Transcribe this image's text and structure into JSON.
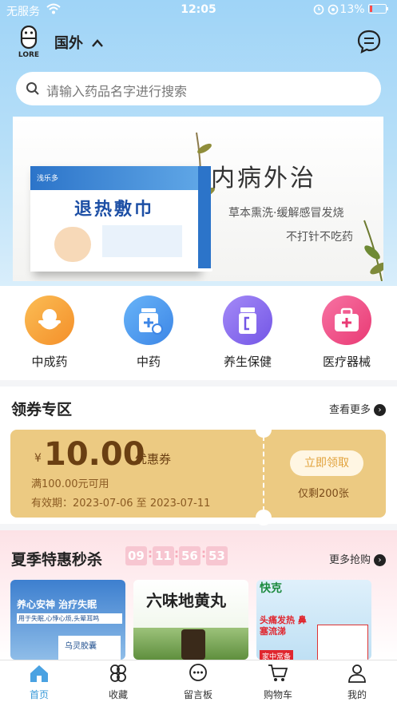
{
  "status_bar": {
    "carrier": "无服务",
    "time": "12:05",
    "battery": "13%"
  },
  "header": {
    "logo_text": "LORE",
    "location": "国外"
  },
  "search": {
    "placeholder": "请输入药品名字进行搜索"
  },
  "banner": {
    "product_name": "退热敷巾",
    "headline": "内病外治",
    "line1": "草本熏洗·缓解感冒发烧",
    "line2": "不打针不吃药",
    "brand": "浅乐多"
  },
  "categories": [
    {
      "label": "中成药",
      "color": "#f7a13c"
    },
    {
      "label": "中药",
      "color": "#4f9ef0"
    },
    {
      "label": "养生保健",
      "color": "#8a6ff0"
    },
    {
      "label": "医疗器械",
      "color": "#f2508a"
    }
  ],
  "coupon_section": {
    "title": "领券专区",
    "more": "查看更多"
  },
  "coupon": {
    "currency": "¥",
    "amount": "10.00",
    "type": "优惠券",
    "condition": "满100.00元可用",
    "validity": "有效期：2023-07-06 至 2023-07-11",
    "button": "立即领取",
    "remaining": "仅剩200张"
  },
  "flash_sale": {
    "title": "夏季特惠秒杀",
    "hours": "09",
    "minutes": "11",
    "seconds": "56",
    "millis": "53",
    "more": "更多抢购"
  },
  "products": [
    {
      "line1": "养心安神 治疗失眠",
      "line2": "用于失眠,心悸心烦,头晕耳鸣",
      "name": "乌灵胶囊"
    },
    {
      "line1": "六味地黄丸",
      "line2": "",
      "name": ""
    },
    {
      "line1": "快克",
      "line2": "头痛发热 鼻塞流涕",
      "name": "家中常备"
    }
  ],
  "tabbar": [
    {
      "label": "首页",
      "active": true
    },
    {
      "label": "收藏",
      "active": false
    },
    {
      "label": "留言板",
      "active": false
    },
    {
      "label": "购物车",
      "active": false
    },
    {
      "label": "我的",
      "active": false
    }
  ]
}
